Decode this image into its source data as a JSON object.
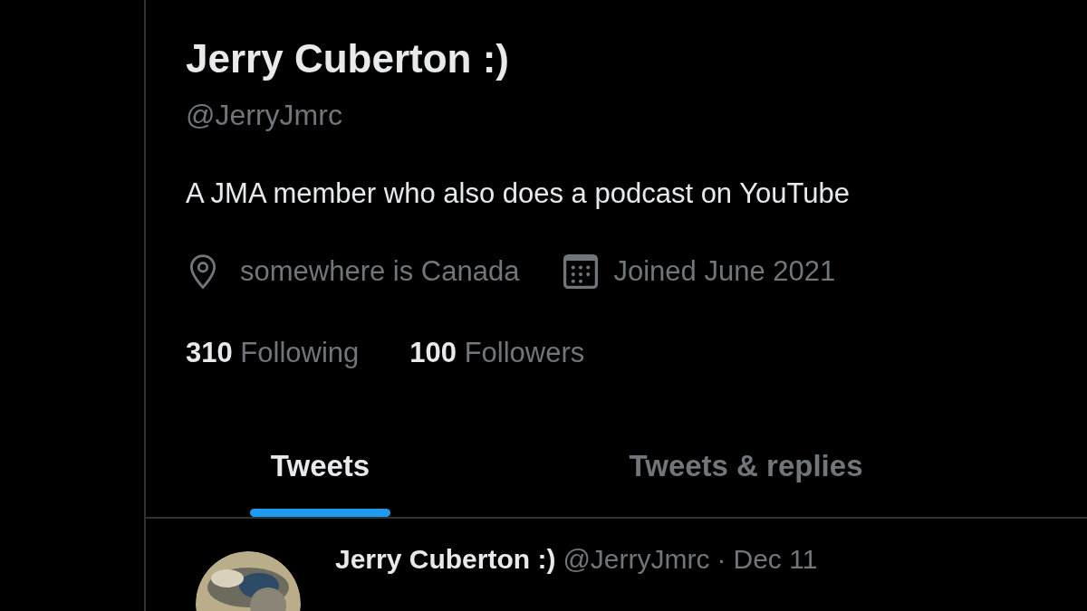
{
  "profile": {
    "name": "Jerry Cuberton :)",
    "handle": "@JerryJmrc",
    "bio": "A JMA member who also does a podcast on YouTube",
    "location": "somewhere is Canada",
    "joined": "Joined June 2021"
  },
  "stats": [
    {
      "count": "310",
      "label": "Following"
    },
    {
      "count": "100",
      "label": "Followers"
    }
  ],
  "tabs": [
    {
      "label": "Tweets",
      "selected": true
    },
    {
      "label": "Tweets & replies",
      "selected": false
    }
  ],
  "tweet": {
    "name": "Jerry Cuberton :)",
    "handle": "@JerryJmrc",
    "separator": "·",
    "date": "Dec 11"
  }
}
